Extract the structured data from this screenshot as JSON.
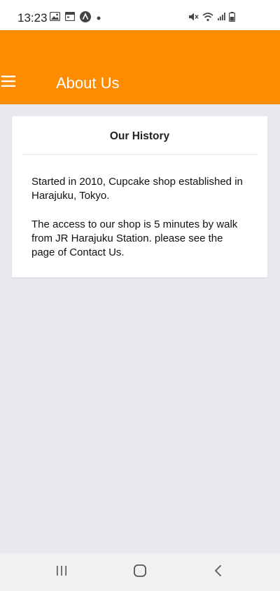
{
  "status_bar": {
    "time": "13:23",
    "left_icons": [
      "image-icon",
      "calendar-icon",
      "app-icon",
      "dot-icon"
    ],
    "right_icons": [
      "mute-icon",
      "wifi-icon",
      "signal-icon",
      "battery-icon"
    ]
  },
  "app_bar": {
    "title": "About Us",
    "color": "#fd8c00",
    "menu_icon": "hamburger-menu-icon"
  },
  "card": {
    "title": "Our History",
    "paragraphs": [
      "Started in 2010, Cupcake shop established in Harajuku, Tokyo.",
      "The access to our shop is 5 minutes by walk from JR Harajuku Station. please see the page of Contact Us."
    ]
  },
  "nav_bar": {
    "buttons": [
      "recents-icon",
      "home-icon",
      "back-icon"
    ]
  }
}
